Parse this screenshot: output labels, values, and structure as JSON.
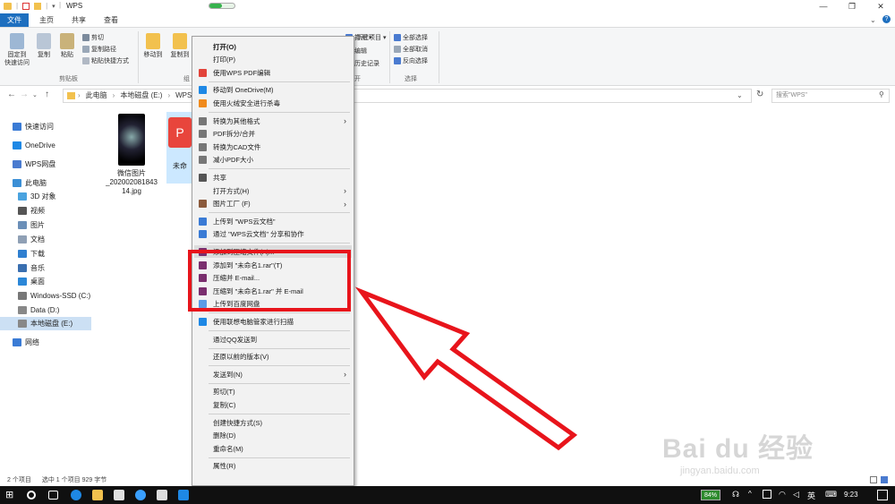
{
  "window": {
    "title": "WPS",
    "controls": [
      "—",
      "❐",
      "✕"
    ]
  },
  "tabs": [
    {
      "label": "文件",
      "active": true
    },
    {
      "label": "主页",
      "active": false
    },
    {
      "label": "共享",
      "active": false
    },
    {
      "label": "查看",
      "active": false
    }
  ],
  "ribbon": {
    "pin_label": "固定到\n快速访问",
    "copy_label": "复制",
    "paste_label": "粘贴",
    "cut_label": "剪切",
    "copy_path_label": "复制路径",
    "paste_shortcut_label": "粘贴快捷方式",
    "clipboard_group": "剪贴板",
    "move_to_label": "移动到",
    "copy_to_label": "复制到",
    "organize_group": "组",
    "new_item_label": "新建项目 ▾",
    "open_label": "打开 ▾",
    "edit_label": "编辑",
    "history_label": "历史记录",
    "open_group": "开",
    "select_all_label": "全部选择",
    "select_none_label": "全部取消",
    "invert_label": "反向选择",
    "select_group": "选择"
  },
  "address": {
    "crumbs": [
      "此电脑",
      "本地磁盘 (E:)",
      "WPS"
    ],
    "search_placeholder": "搜索\"WPS\""
  },
  "nav": {
    "items": [
      {
        "label": "快速访问",
        "icon": "star-icon",
        "color": "#3a7bd5",
        "selected": false
      },
      {
        "label": "OneDrive",
        "icon": "cloud-icon",
        "color": "#1e88e5",
        "selected": false
      },
      {
        "label": "WPS网盘",
        "icon": "cloud-drive-icon",
        "color": "#4a7bd0",
        "selected": false
      },
      {
        "label": "此电脑",
        "icon": "computer-icon",
        "color": "#3b8fd6",
        "selected": false
      },
      {
        "label": "3D 对象",
        "icon": "cube-icon",
        "color": "#4aa3df",
        "selected": false
      },
      {
        "label": "视频",
        "icon": "video-icon",
        "color": "#555555",
        "selected": false
      },
      {
        "label": "图片",
        "icon": "pictures-icon",
        "color": "#6b8fb8",
        "selected": false
      },
      {
        "label": "文档",
        "icon": "documents-icon",
        "color": "#8fa0b5",
        "selected": false
      },
      {
        "label": "下载",
        "icon": "download-icon",
        "color": "#2f7fd0",
        "selected": false
      },
      {
        "label": "音乐",
        "icon": "music-icon",
        "color": "#3a6fb0",
        "selected": false
      },
      {
        "label": "桌面",
        "icon": "desktop-icon",
        "color": "#2b87d8",
        "selected": false
      },
      {
        "label": "Windows-SSD (C:)",
        "icon": "drive-icon",
        "color": "#777777",
        "selected": false
      },
      {
        "label": "Data (D:)",
        "icon": "drive-icon",
        "color": "#888888",
        "selected": false
      },
      {
        "label": "本地磁盘 (E:)",
        "icon": "drive-icon",
        "color": "#888888",
        "selected": true
      },
      {
        "label": "网络",
        "icon": "network-icon",
        "color": "#3a7bd5",
        "selected": false
      }
    ]
  },
  "files": [
    {
      "name": "微信图片\n_202002081843\n14.jpg",
      "icon": "image-thumbnail"
    },
    {
      "name": "未命",
      "icon": "wps-pdf-icon"
    }
  ],
  "status": {
    "count": "2 个项目",
    "selection": "选中 1 个项目  929 字节"
  },
  "menu": {
    "items": [
      {
        "label": "打开(O)",
        "bold": true,
        "icon": ""
      },
      {
        "label": "打印(P)",
        "icon": ""
      },
      {
        "label": "使用WPS PDF编辑",
        "icon": "pdf-icon",
        "color": "#e2433a"
      },
      {
        "sep": true
      },
      {
        "label": "移动到 OneDrive(M)",
        "icon": "cloud-icon",
        "color": "#1e88e5"
      },
      {
        "label": "使用火绒安全进行杀毒",
        "icon": "shield-icon",
        "color": "#f08a1c"
      },
      {
        "sep": true
      },
      {
        "label": "转换为其他格式",
        "icon": "convert-icon",
        "color": "#777777",
        "arrow": true
      },
      {
        "label": "PDF拆分/合并",
        "icon": "split-icon",
        "color": "#777777"
      },
      {
        "label": "转换为CAD文件",
        "icon": "cad-icon",
        "color": "#777777"
      },
      {
        "label": "减小PDF大小",
        "icon": "compress-pdf-icon",
        "color": "#777777"
      },
      {
        "sep": true
      },
      {
        "label": "共享",
        "icon": "share-icon",
        "color": "#555555"
      },
      {
        "label": "打开方式(H)",
        "icon": "",
        "arrow": true
      },
      {
        "label": "图片工厂 (F)",
        "icon": "picture-factory-icon",
        "color": "#8b5a3c",
        "arrow": true
      },
      {
        "sep": true
      },
      {
        "label": "上传到 \"WPS云文档\"",
        "icon": "wps-cloud-icon",
        "color": "#3a7bd5"
      },
      {
        "label": "通过 \"WPS云文档\" 分享和协作",
        "icon": "wps-share-icon",
        "color": "#3a7bd5"
      },
      {
        "sep": true
      },
      {
        "label": "添加到压缩文件(A)...",
        "icon": "winrar-icon",
        "color": "#7a2e6e",
        "highlight": true
      },
      {
        "label": "添加到 \"未命名1.rar\"(T)",
        "icon": "winrar-icon",
        "color": "#7a2e6e"
      },
      {
        "label": "压缩并 E-mail...",
        "icon": "winrar-icon",
        "color": "#7a2e6e"
      },
      {
        "label": "压缩到 \"未命名1.rar\" 并 E-mail",
        "icon": "winrar-icon",
        "color": "#7a2e6e"
      },
      {
        "label": "上传到百度网盘",
        "icon": "baidu-cloud-icon",
        "color": "#5a9be6"
      },
      {
        "sep": true
      },
      {
        "label": "使用联想电脑管家进行扫描",
        "icon": "lenovo-scan-icon",
        "color": "#1e88e5"
      },
      {
        "sep": true
      },
      {
        "label": "通过QQ发送到",
        "icon": ""
      },
      {
        "sep": true
      },
      {
        "label": "还原以前的版本(V)",
        "icon": ""
      },
      {
        "sep": true
      },
      {
        "label": "发送到(N)",
        "icon": "",
        "arrow": true
      },
      {
        "sep": true
      },
      {
        "label": "剪切(T)",
        "icon": ""
      },
      {
        "label": "复制(C)",
        "icon": ""
      },
      {
        "sep": true
      },
      {
        "label": "创建快捷方式(S)",
        "icon": ""
      },
      {
        "label": "删除(D)",
        "icon": ""
      },
      {
        "label": "重命名(M)",
        "icon": ""
      },
      {
        "sep": true
      },
      {
        "label": "属性(R)",
        "icon": ""
      }
    ]
  },
  "taskbar": {
    "battery": "84%",
    "ime": "英",
    "time": "9:23"
  },
  "watermark": {
    "brand": "Bai du 经验",
    "url": "jingyan.baidu.com"
  },
  "colors": {
    "accent": "#1e6fbf",
    "highlight_box": "#e8141b",
    "arrow": "#e8141b"
  }
}
